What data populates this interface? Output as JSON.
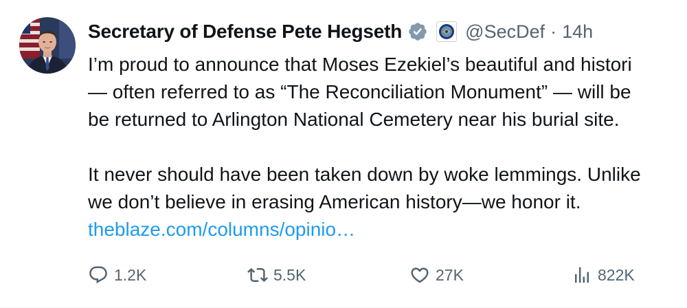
{
  "author": {
    "display_name": "Secretary of Defense Pete Hegseth",
    "handle": "@SecDef",
    "separator": "·",
    "time": "14h",
    "verified_icon": "gray-verified-badge-icon",
    "affiliation_icon": "department-of-defense-seal-icon"
  },
  "body": {
    "line1": "I’m proud to announce that Moses Ezekiel’s beautiful and histori",
    "line2": "— often referred to as “The Reconciliation Monument” — will be",
    "line3": "be returned to Arlington National Cemetery near his burial site.",
    "line4": "It never should have been taken down by woke lemmings. Unlike",
    "line5": "we don’t believe in erasing American history—we honor it.",
    "link": "theblaze.com/columns/opinio…"
  },
  "actions": {
    "replies": "1.2K",
    "reposts": "5.5K",
    "likes": "27K",
    "views": "822K"
  },
  "colors": {
    "text": "#0f1419",
    "secondary": "#536471",
    "link": "#1d9bf0",
    "verified_gray": "#829aab"
  }
}
